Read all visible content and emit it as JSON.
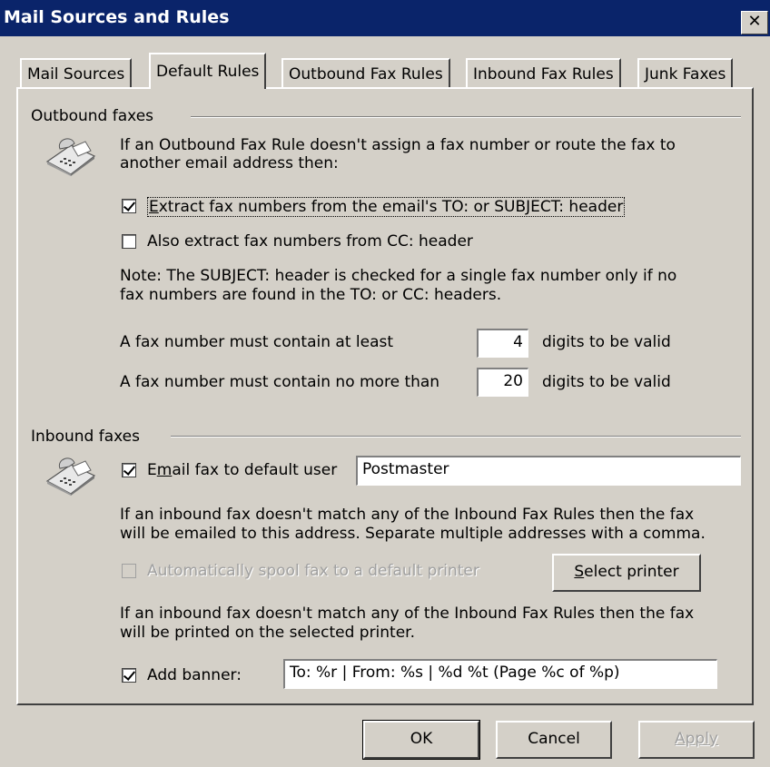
{
  "window": {
    "title": "Mail Sources and Rules",
    "close_glyph": "✕"
  },
  "tabs": [
    {
      "label": "Mail Sources"
    },
    {
      "label": "Default Rules"
    },
    {
      "label": "Outbound Fax Rules"
    },
    {
      "label": "Inbound Fax Rules"
    },
    {
      "label": "Junk Faxes"
    }
  ],
  "outbound": {
    "group_label": "Outbound faxes",
    "icon": "fax-machine-icon",
    "intro_line1": "If an Outbound Fax Rule doesn't assign a fax number or route the fax to",
    "intro_line2": "another email address then:",
    "extract_to_subject": {
      "label_underline": "E",
      "label_rest": "xtract fax numbers from the email's TO: or SUBJECT: header",
      "checked": true
    },
    "extract_cc": {
      "label": "Also extract fax numbers from CC: header",
      "checked": false
    },
    "note_line1": "Note:  The SUBJECT: header is checked for a single fax number only if no",
    "note_line2": "fax numbers are found in the TO: or CC: headers.",
    "min_digits_label": "A fax number must contain at least",
    "min_digits_value": "4",
    "min_digits_suffix": "digits to be valid",
    "max_digits_label": "A fax number must contain no more than",
    "max_digits_value": "20",
    "max_digits_suffix": "digits to be valid"
  },
  "inbound": {
    "group_label": "Inbound faxes",
    "icon": "fax-machine-icon",
    "email_default": {
      "label_pre": "E",
      "label_underline": "m",
      "label_rest": "ail fax to default user",
      "checked": true,
      "value": "Postmaster"
    },
    "email_note_line1": "If an inbound fax doesn't match any of the Inbound Fax Rules then the fax",
    "email_note_line2": "will be emailed to this address.  Separate multiple addresses with a comma.",
    "auto_spool": {
      "label": "Automatically spool fax to a default printer",
      "checked": false,
      "disabled": true
    },
    "select_printer": {
      "label_underline": "S",
      "label_rest": "elect printer"
    },
    "print_note_line1": "If an inbound fax doesn't match any of the Inbound Fax Rules then the fax",
    "print_note_line2": "will be printed on the selected printer.",
    "banner": {
      "label": "Add banner:",
      "checked": true,
      "value": "To: %r | From: %s | %d %t  (Page %c of %p)"
    }
  },
  "buttons": {
    "ok": "OK",
    "cancel": "Cancel",
    "apply": "Apply"
  }
}
